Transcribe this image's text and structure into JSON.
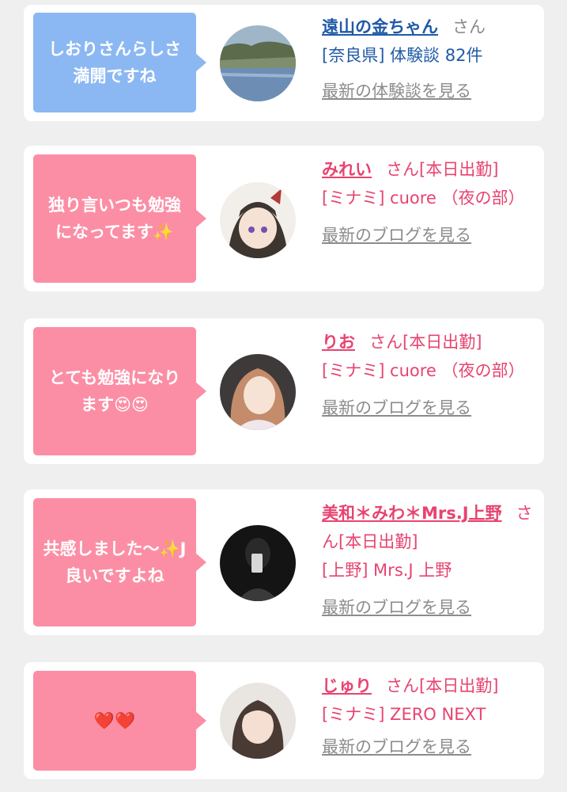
{
  "cards": [
    {
      "message": "しおりさんらしさ満開ですね",
      "name": "遠山の金ちゃん",
      "suffix": "さん",
      "detail": "[奈良県] 体験談 82件",
      "link": "最新の体験談を見る",
      "avatar": "lake-landscape-photo",
      "theme": "blue"
    },
    {
      "message": "独り言いつも勉強になってます✨",
      "name": "みれい",
      "suffix": "さん[本日出勤]",
      "detail": "[ミナミ] cuore （夜の部）",
      "link": "最新のブログを見る",
      "avatar": "anime-girl-illustration",
      "theme": "pink"
    },
    {
      "message": "とても勉強になります😍😍",
      "name": "りお",
      "suffix": "さん[本日出勤]",
      "detail": "[ミナミ] cuore （夜の部）",
      "link": "最新のブログを見る",
      "avatar": "woman-portrait-photo",
      "theme": "pink"
    },
    {
      "message": "共感しました〜✨J良いですよね",
      "name": "美和＊みわ＊Mrs.J上野",
      "suffix": "さん[本日出勤]",
      "detail": "[上野] Mrs.J 上野",
      "link": "最新のブログを見る",
      "avatar": "mirror-selfie-photo",
      "theme": "pink"
    },
    {
      "message": "❤️❤️",
      "name": "じゅり",
      "suffix": "さん[本日出勤]",
      "detail": "[ミナミ] ZERO NEXT",
      "link": "最新のブログを見る",
      "avatar": "woman-portrait-photo",
      "theme": "pink"
    }
  ]
}
